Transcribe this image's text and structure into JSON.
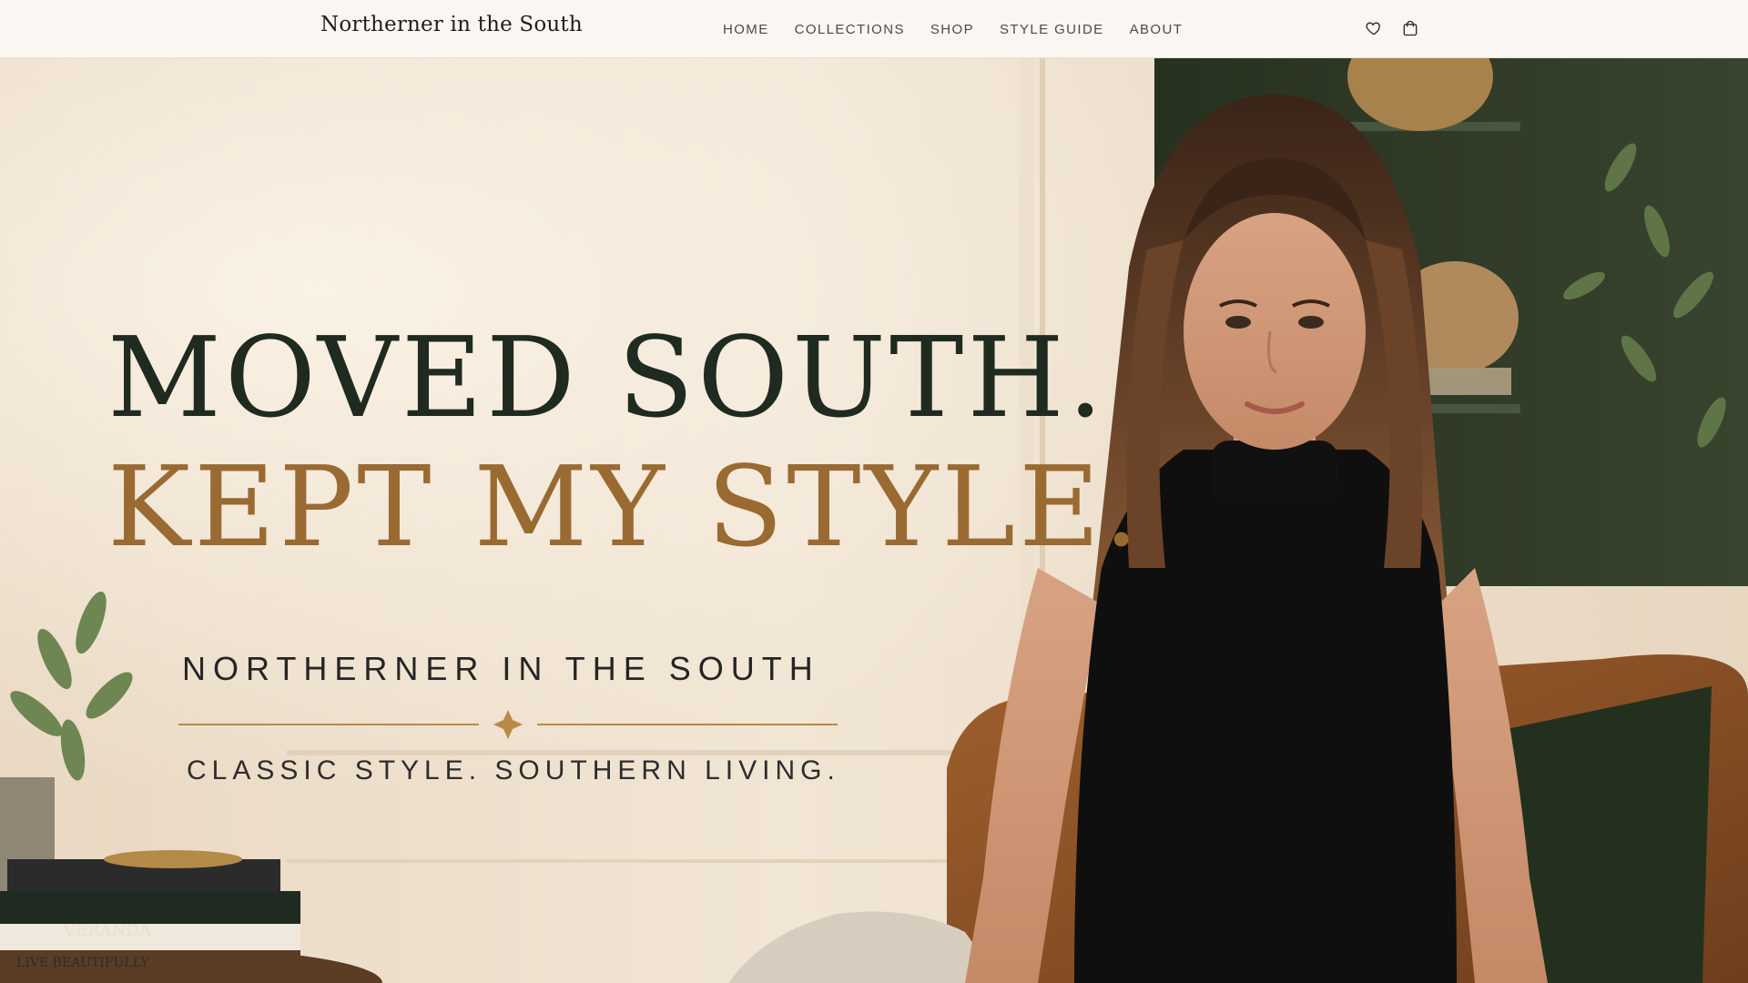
{
  "nav": {
    "brand": "Northerner in the South",
    "items": [
      {
        "label": "HOME"
      },
      {
        "label": "COLLECTIONS"
      },
      {
        "label": "SHOP"
      },
      {
        "label": "STYLE GUIDE"
      },
      {
        "label": "ABOUT"
      }
    ],
    "icons": [
      "heart-icon",
      "shopping-bag-icon"
    ]
  },
  "hero": {
    "headline_line1": "MOVED SOUTH.",
    "headline_line2": "KEPT MY STYLE.",
    "brand_line": "NORTHERNER IN THE SOUTH",
    "tagline": "CLASSIC STYLE. SOUTHERN LIVING.",
    "books": [
      "VERANDA",
      "LIVE BEAUTIFULLY"
    ]
  },
  "colors": {
    "headline_dark": "#1f2a20",
    "headline_gold": "#9a6a33",
    "accent_gold": "#b98a45",
    "shelf_green": "#2f3a2c",
    "wall_cream": "#efe2cf"
  }
}
